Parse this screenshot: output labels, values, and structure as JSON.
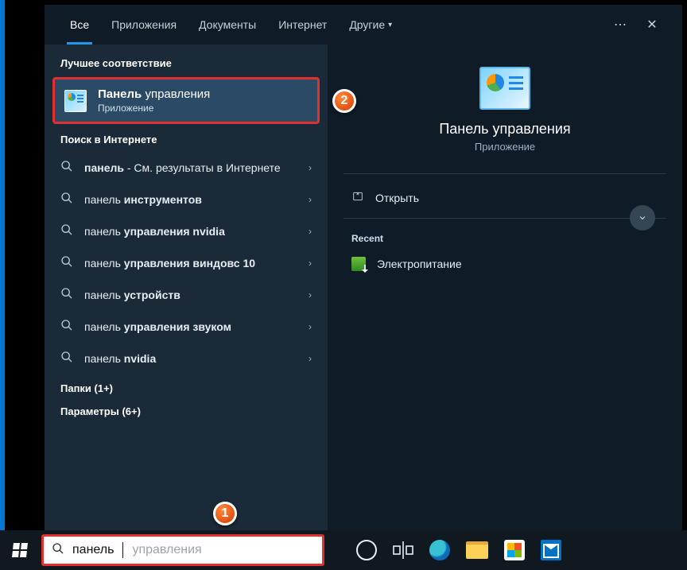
{
  "tabs": {
    "all": "Все",
    "apps": "Приложения",
    "docs": "Документы",
    "internet": "Интернет",
    "more": "Другие"
  },
  "sections": {
    "best": "Лучшее соответствие",
    "web": "Поиск в Интернете"
  },
  "best": {
    "title_b": "Панель",
    "title_r": " управления",
    "subtitle": "Приложение"
  },
  "webresults": [
    {
      "b": "панель",
      "r": " - См. результаты в Интернете"
    },
    {
      "b": "",
      "r": "панель ",
      "b2": "инструментов"
    },
    {
      "b": "",
      "r": "панель ",
      "b2": "управления nvidia"
    },
    {
      "b": "",
      "r": "панель ",
      "b2": "управления виндовс 10"
    },
    {
      "b": "",
      "r": "панель ",
      "b2": "устройств"
    },
    {
      "b": "",
      "r": "панель ",
      "b2": "управления звуком"
    },
    {
      "b": "",
      "r": "панель ",
      "b2": "nvidia"
    }
  ],
  "folders": "Папки (1+)",
  "settings": "Параметры (6+)",
  "details": {
    "title": "Панель управления",
    "subtitle": "Приложение",
    "open": "Открыть",
    "recent": "Recent",
    "recent_item": "Электропитание"
  },
  "search": {
    "typed": "панель",
    "hint": " управления"
  },
  "callouts": {
    "c1": "1",
    "c2": "2"
  }
}
